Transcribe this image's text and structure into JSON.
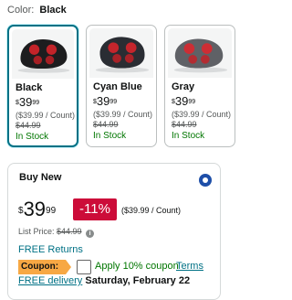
{
  "color_selector": {
    "label": "Color:",
    "selected": "Black"
  },
  "swatches": [
    {
      "name": "Black",
      "price_symbol": "$",
      "price_whole": "39",
      "price_fraction": "99",
      "unit_price": "($39.99 / Count)",
      "list_price": "$44.99",
      "availability": "In Stock",
      "body_color": "#1d1d1f",
      "selected": true
    },
    {
      "name": "Cyan Blue",
      "price_symbol": "$",
      "price_whole": "39",
      "price_fraction": "99",
      "unit_price": "($39.99 / Count)",
      "list_price": "$44.99",
      "availability": "In Stock",
      "body_color": "#2a2d33",
      "selected": false
    },
    {
      "name": "Gray",
      "price_symbol": "$",
      "price_whole": "39",
      "price_fraction": "99",
      "unit_price": "($39.99 / Count)",
      "list_price": "$44.99",
      "availability": "In Stock",
      "body_color": "#5f6166",
      "selected": false
    }
  ],
  "buy_box": {
    "title": "Buy New",
    "price_symbol": "$",
    "price_whole": "39",
    "price_fraction": "99",
    "discount": "-11%",
    "unit_price": "($39.99 / Count)",
    "list_price_label": "List Price:",
    "list_price": "$44.99",
    "info_icon": "i",
    "returns": "FREE Returns",
    "coupon_badge": "Coupon:",
    "coupon_text": "Apply 10% coupon",
    "coupon_terms": "Terms",
    "delivery_link": "FREE delivery",
    "delivery_date": "Saturday, February 22"
  },
  "colors": {
    "accent": "#007185",
    "in_stock": "#007600",
    "discount_bg": "#cc0c39",
    "coupon_bg": "#f7a844",
    "radio": "#1e4fa8",
    "massage_node_glow": "#e0252b"
  }
}
